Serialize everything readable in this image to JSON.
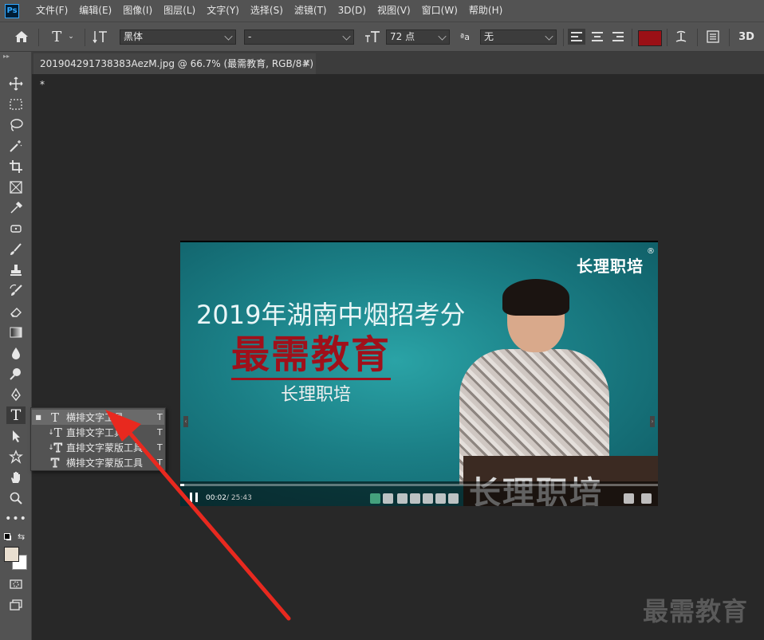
{
  "menubar": {
    "logo": "Ps",
    "items": [
      "文件(F)",
      "编辑(E)",
      "图像(I)",
      "图层(L)",
      "文字(Y)",
      "选择(S)",
      "滤镜(T)",
      "3D(D)",
      "视图(V)",
      "窗口(W)",
      "帮助(H)"
    ]
  },
  "options": {
    "font_family": "黑体",
    "font_style": "-",
    "font_size": "72 点",
    "antialias_symbol": "ªa",
    "antialias": "无",
    "text_color": "#9b1016",
    "threed_label": "3D"
  },
  "document_tab": {
    "title": "201904291738383AezM.jpg @ 66.7% (最需教育, RGB/8#) *",
    "close": "×"
  },
  "flyout": {
    "items": [
      {
        "label": "横排文字工具",
        "shortcut": "T",
        "selected": true
      },
      {
        "label": "直排文字工具",
        "shortcut": "T",
        "selected": false
      },
      {
        "label": "直排文字蒙版工具",
        "shortcut": "T",
        "selected": false
      },
      {
        "label": "横排文字蒙版工具",
        "shortcut": "T",
        "selected": false
      }
    ]
  },
  "image": {
    "brand": "长理职培",
    "reg": "®",
    "title": "2019年湖南中烟招考分",
    "big_text": "最需教育",
    "sub_text": "长理职培",
    "podium_text": "长理职培",
    "time_current": "00:02",
    "time_total": "/ 25:43",
    "progress": 0.0013
  },
  "colors": {
    "foreground": "#e9dfd0",
    "background": "#ffffff",
    "arrow": "#e8291f"
  },
  "watermark": "最需教育"
}
